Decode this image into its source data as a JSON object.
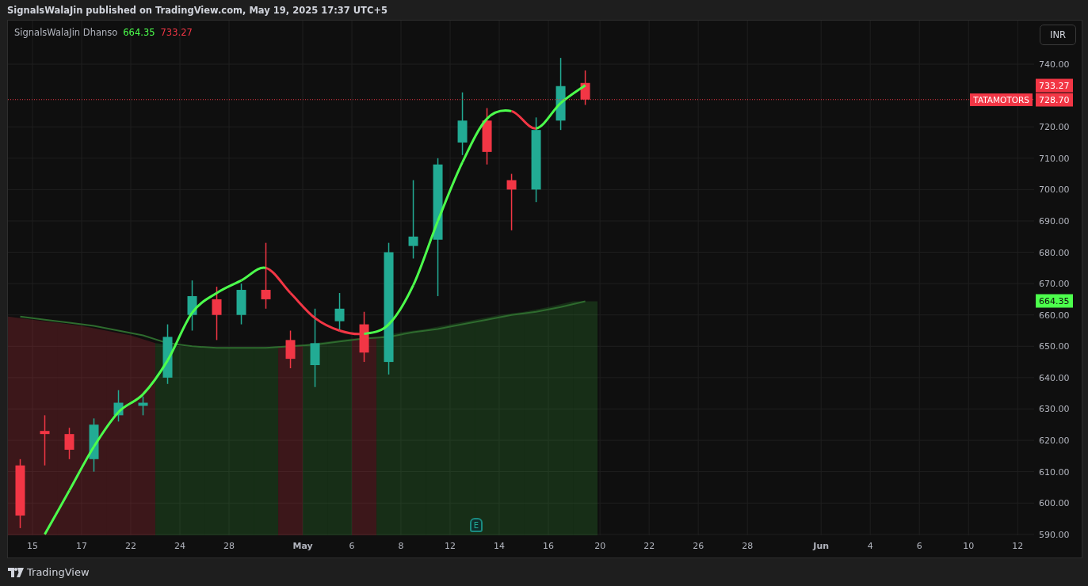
{
  "header": {
    "text": "SignalsWalaJin published on TradingView.com, May 19, 2025 17:37 UTC+5"
  },
  "chart": {
    "legend": {
      "name": "SignalsWalaJin Dhanso",
      "values": [
        {
          "text": "664.35",
          "color": "#4cff4c"
        },
        {
          "text": "733.27",
          "color": "#f23645"
        }
      ]
    },
    "currency_button": "INR",
    "price_tags": [
      {
        "text": "733.27",
        "color": "#f23645"
      },
      {
        "text": "728.70",
        "color": "#f23645",
        "symbol": "TATAMOTORS"
      },
      {
        "text": "664.35",
        "color": "#4cff4c"
      }
    ],
    "event_marker": "E",
    "price_axis": [
      "740.00",
      "720.00",
      "710.00",
      "700.00",
      "690.00",
      "680.00",
      "670.00",
      "660.00",
      "650.00",
      "640.00",
      "630.00",
      "620.00",
      "610.00",
      "600.00",
      "590.00"
    ],
    "time_axis": [
      {
        "text": "15",
        "bold": false
      },
      {
        "text": "17",
        "bold": false
      },
      {
        "text": "22",
        "bold": false
      },
      {
        "text": "24",
        "bold": false
      },
      {
        "text": "28",
        "bold": false
      },
      {
        "text": "May",
        "bold": true
      },
      {
        "text": "6",
        "bold": false
      },
      {
        "text": "8",
        "bold": false
      },
      {
        "text": "12",
        "bold": false
      },
      {
        "text": "14",
        "bold": false
      },
      {
        "text": "16",
        "bold": false
      },
      {
        "text": "20",
        "bold": false
      },
      {
        "text": "22",
        "bold": false
      },
      {
        "text": "26",
        "bold": false
      },
      {
        "text": "28",
        "bold": false
      },
      {
        "text": "Jun",
        "bold": true
      },
      {
        "text": "4",
        "bold": false
      },
      {
        "text": "6",
        "bold": false
      },
      {
        "text": "10",
        "bold": false
      },
      {
        "text": "12",
        "bold": false
      }
    ]
  },
  "footer": {
    "brand": "TradingView"
  }
}
